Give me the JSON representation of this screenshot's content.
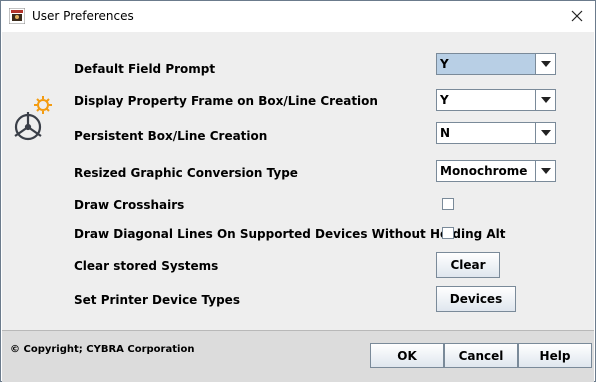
{
  "window": {
    "title": "User Preferences"
  },
  "settings": {
    "default_field_prompt": {
      "label": "Default Field Prompt",
      "value": "Y"
    },
    "display_property_frame": {
      "label": "Display Property Frame on Box/Line Creation",
      "value": "Y"
    },
    "persistent_box_line": {
      "label": "Persistent Box/Line Creation",
      "value": "N"
    },
    "resized_graphic": {
      "label": "Resized Graphic Conversion Type",
      "value": "Monochrome"
    },
    "draw_crosshairs": {
      "label": "Draw Crosshairs",
      "checked": false
    },
    "draw_diagonal": {
      "label": "Draw Diagonal Lines On Supported Devices Without Holding Alt",
      "checked": false
    },
    "clear_systems": {
      "label": "Clear stored Systems",
      "button": "Clear"
    },
    "printer_device_types": {
      "label": "Set Printer Device Types",
      "button": "Devices"
    }
  },
  "footer": {
    "copyright": "© Copyright; CYBRA Corporation",
    "ok": "OK",
    "cancel": "Cancel",
    "help": "Help"
  },
  "colors": {
    "selected_combo": "#b8cfe5",
    "gear_orange": "#f39c12",
    "gear_dark": "#3a3f48"
  }
}
